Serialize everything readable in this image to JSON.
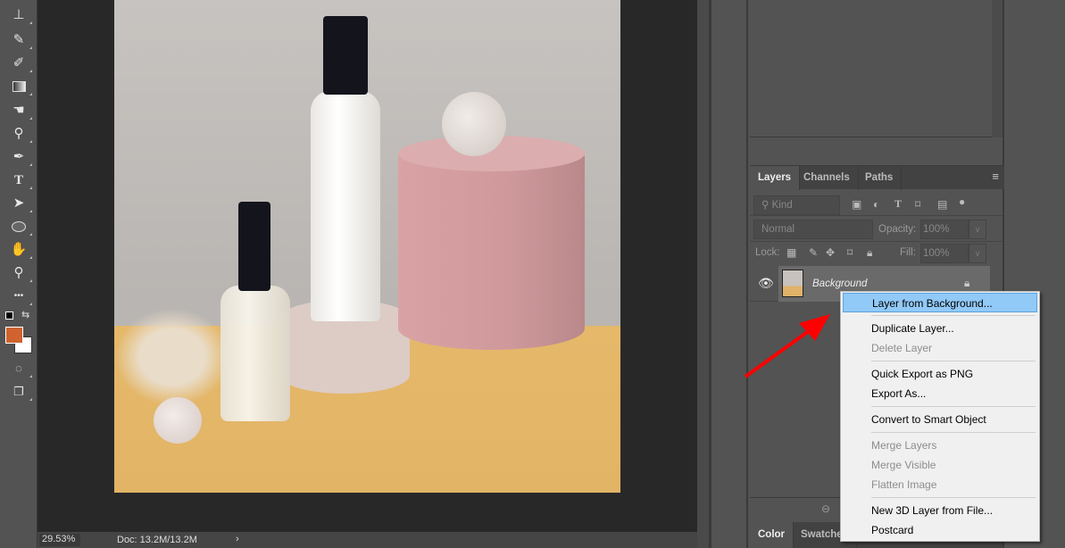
{
  "toolbar": {
    "tools": [
      "stamp-icon",
      "history-brush-icon",
      "eraser-icon",
      "gradient-icon",
      "smudge-icon",
      "dodge-icon",
      "pen-icon",
      "type-icon",
      "path-selection-icon",
      "ellipse-icon",
      "hand-icon",
      "zoom-icon",
      "more-icon"
    ],
    "foreground_color": "#d0632f",
    "background_color": "#ffffff",
    "type_glyph": "T",
    "more_glyph": "•••"
  },
  "status": {
    "zoom": "29.53%",
    "doc": "Doc: 13.2M/13.2M",
    "arrow": "›"
  },
  "layers_panel": {
    "tabs": [
      "Layers",
      "Channels",
      "Paths"
    ],
    "filter_kind": "Kind",
    "blend_mode": "Normal",
    "opacity_label": "Opacity:",
    "opacity": "100%",
    "lock_label": "Lock:",
    "fill_label": "Fill:",
    "fill": "100%",
    "layers": [
      {
        "name": "Background",
        "visible": true,
        "locked": true
      }
    ]
  },
  "bottom_tabs": [
    "Color",
    "Swatches"
  ],
  "context_menu": {
    "items": [
      {
        "label": "Layer from Background...",
        "enabled": true,
        "highlighted": true
      },
      {
        "label": "Duplicate Layer...",
        "enabled": true
      },
      {
        "label": "Delete Layer",
        "enabled": false
      },
      {
        "label": "Quick Export as PNG",
        "enabled": true
      },
      {
        "label": "Export As...",
        "enabled": true
      },
      {
        "label": "Convert to Smart Object",
        "enabled": true
      },
      {
        "label": "Merge Layers",
        "enabled": false
      },
      {
        "label": "Merge Visible",
        "enabled": false
      },
      {
        "label": "Flatten Image",
        "enabled": false
      },
      {
        "label": "New 3D Layer from File...",
        "enabled": true
      },
      {
        "label": "Postcard",
        "enabled": true
      }
    ]
  },
  "annotation": {
    "arrow_color": "#ff0000"
  }
}
